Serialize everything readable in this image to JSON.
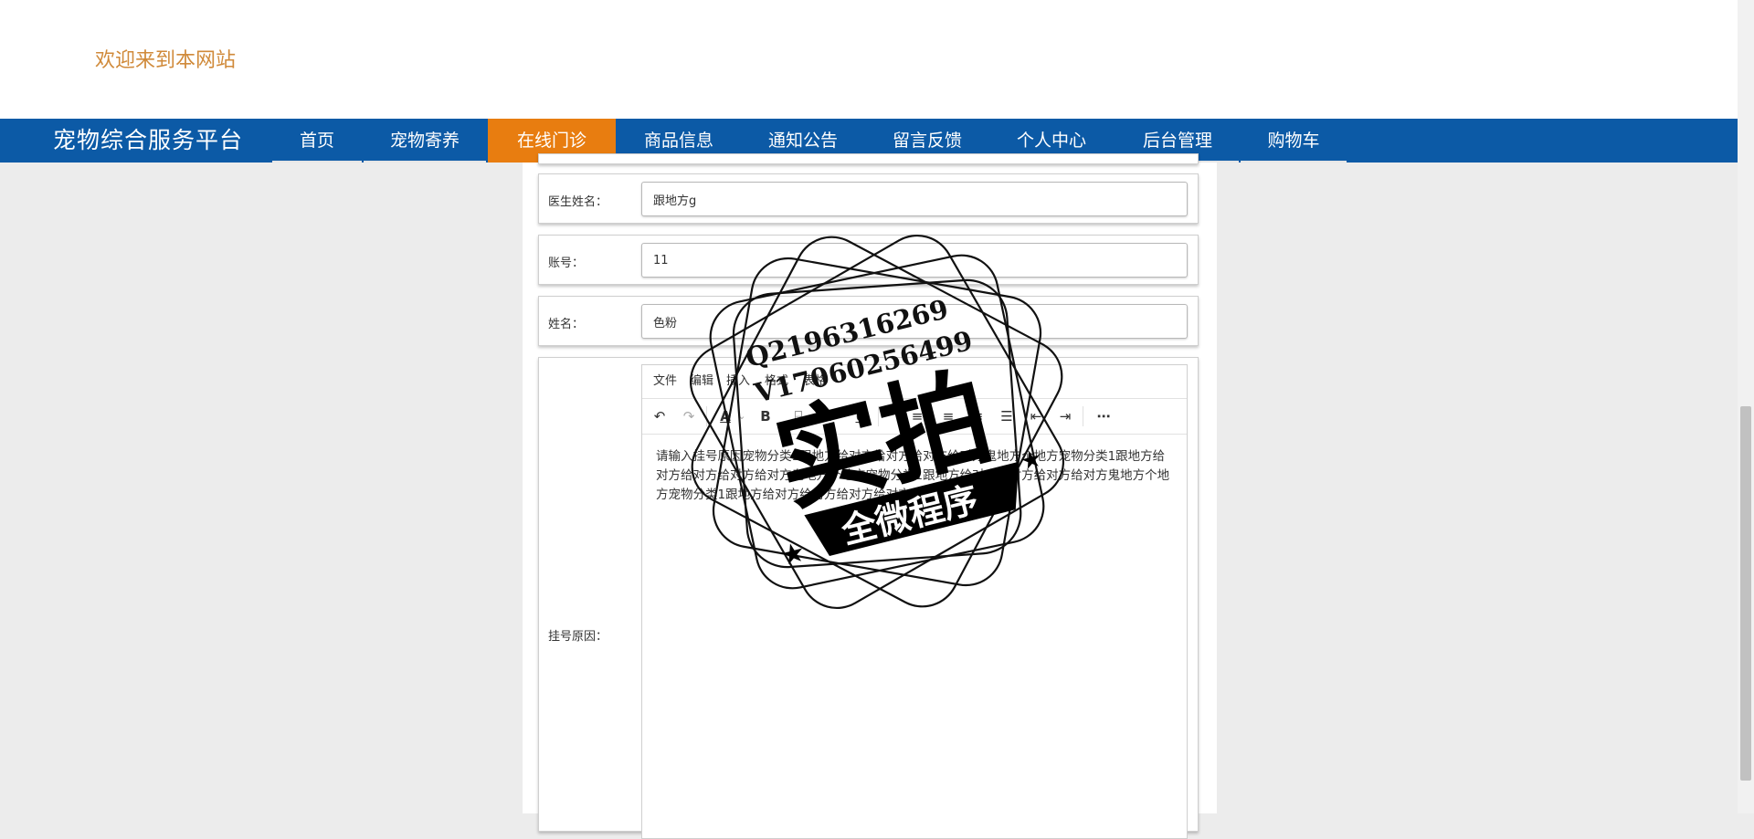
{
  "header": {
    "welcome": "欢迎来到本网站"
  },
  "nav": {
    "brand": "宠物综合服务平台",
    "items": [
      "首页",
      "宠物寄养",
      "在线门诊",
      "商品信息",
      "通知公告",
      "留言反馈",
      "个人中心",
      "后台管理",
      "购物车"
    ],
    "active": "在线门诊"
  },
  "form": {
    "doctor": {
      "label": "医生姓名：",
      "value": "跟地方g"
    },
    "account": {
      "label": "账号：",
      "value": "11"
    },
    "name": {
      "label": "姓名：",
      "value": "色粉"
    },
    "reason": {
      "label": "挂号原因：",
      "menu": [
        "文件",
        "编辑",
        "插入",
        "格式",
        "表格"
      ],
      "content": "请输入挂号原因宠物分类1跟地方给对方给对方给对方给对方鬼地方个地方宠物分类1跟地方给对方给对方给对方给对方鬼地方个地方宠物分类1跟地方给对方给对方给对方给对方鬼地方个地方宠物分类1跟地方给对方给对方给对方给对方鬼地方个地方"
    }
  },
  "watermark": {
    "line1": "Q2196316269",
    "line2": "V17060256499",
    "main": "实拍",
    "sub": "全微程序"
  }
}
